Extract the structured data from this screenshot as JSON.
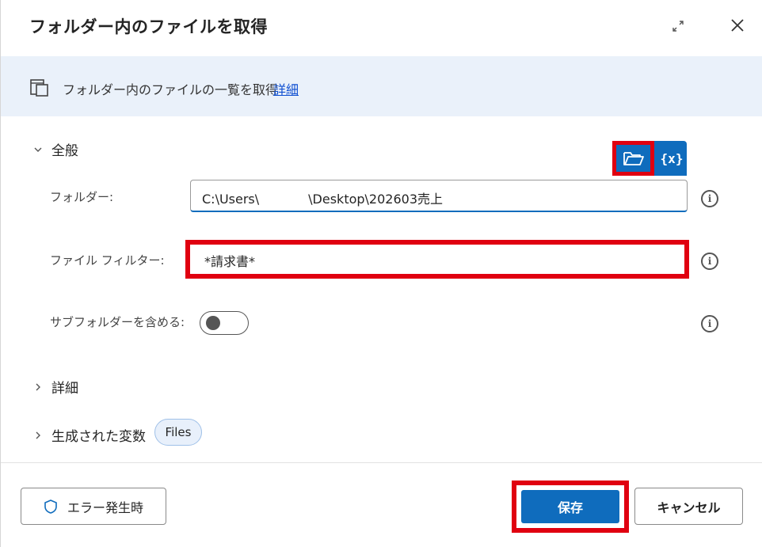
{
  "dialog": {
    "title": "フォルダー内のファイルを取得"
  },
  "banner": {
    "text": "フォルダー内のファイルの一覧を取得",
    "link_label": "詳細"
  },
  "sections": {
    "general": "全般",
    "advanced": "詳細",
    "variables": "生成された変数"
  },
  "fields": {
    "folder": {
      "label": "フォルダー:",
      "value_part1": "C:\\Users\\",
      "value_part2": "\\Desktop\\202603売上"
    },
    "filter": {
      "label": "ファイル フィルター:",
      "value": "*請求書*"
    },
    "subfolder": {
      "label": "サブフォルダーを含める:",
      "enabled": false
    }
  },
  "variables": {
    "files_badge": "Files"
  },
  "buttons": {
    "var_label": "{x}",
    "error": "エラー発生時",
    "save": "保存",
    "cancel": "キャンセル"
  },
  "colors": {
    "accent": "#0f6cbd",
    "highlight": "#e00010",
    "banner_bg": "#eaf1fa"
  },
  "icons": {
    "expand": "expand-icon",
    "close": "close-icon",
    "banner": "copy-folder-icon",
    "browse": "folder-open-icon",
    "info": "info-icon",
    "shield": "shield-icon"
  }
}
